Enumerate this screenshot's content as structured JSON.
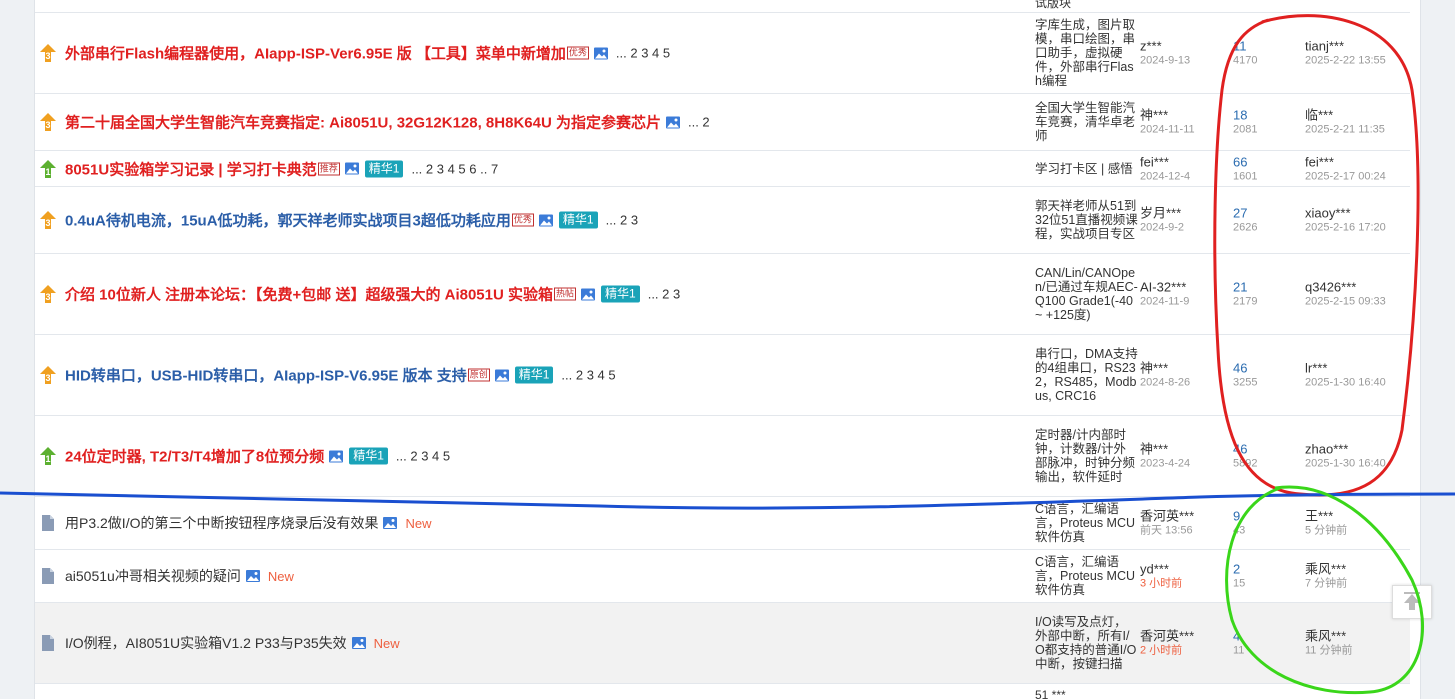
{
  "top_partial": "试版块",
  "bottom_partial": "51 ***",
  "threads": [
    {
      "title": "外部串行Flash编程器使用，AIapp-ISP-Ver6.95E 版 【工具】菜单中新增加",
      "color": "red",
      "icon": "orange",
      "badge": "优秀",
      "jinghua": "",
      "pages": "... 2 3 4 5",
      "forum": "字库生成，图片取模，串口绘图，串口助手，虚拟硬件，外部串行Flash编程",
      "author": "z***",
      "date": "2024-9-13",
      "replies": "11",
      "views": "4170",
      "last_user": "tianj***",
      "last_time": "2025-2-22 13:55"
    },
    {
      "title": "第二十届全国大学生智能汽车竞赛指定: Ai8051U, 32G12K128, 8H8K64U 为指定参赛芯片",
      "color": "red",
      "icon": "orange",
      "badge": "",
      "jinghua": "",
      "pages": "... 2",
      "forum": "全国大学生智能汽车竞赛，清华卓老师",
      "author": "神***",
      "date": "2024-11-11",
      "replies": "18",
      "views": "2081",
      "last_user": "临***",
      "last_time": "2025-2-21 11:35"
    },
    {
      "title": "8051U实验箱学习记录 | 学习打卡典范",
      "color": "red",
      "icon": "green",
      "badge": "推荐",
      "jinghua": "精华1",
      "pages": "... 2 3 4 5 6 .. 7",
      "forum": "学习打卡区 | 感悟",
      "author": "fei***",
      "date": "2024-12-4",
      "replies": "66",
      "views": "1601",
      "last_user": "fei***",
      "last_time": "2025-2-17 00:24"
    },
    {
      "title": "0.4uA待机电流，15uA低功耗，郭天祥老师实战项目3超低功耗应用",
      "color": "blue",
      "icon": "orange",
      "badge": "优秀",
      "jinghua": "精华1",
      "pages": "... 2 3",
      "forum": "郭天祥老师从51到32位51直播视频课程，实战项目专区",
      "author": "岁月***",
      "date": "2024-9-2",
      "replies": "27",
      "views": "2626",
      "last_user": "xiaoy***",
      "last_time": "2025-2-16 17:20"
    },
    {
      "title": "介绍 10位新人 注册本论坛：【免费+包邮 送】超级强大的 Ai8051U 实验箱",
      "color": "red",
      "icon": "orange",
      "badge": "热帖",
      "jinghua": "精华1",
      "pages": "... 2 3",
      "forum": "CAN/Lin/CANOpen/已通过车规AEC-Q100 Grade1(-40 ~ +125度)",
      "author": "AI-32***",
      "date": "2024-11-9",
      "replies": "21",
      "views": "2179",
      "last_user": "q3426***",
      "last_time": "2025-2-15 09:33"
    },
    {
      "title": "HID转串口，USB-HID转串口，AIapp-ISP-V6.95E 版本 支持",
      "color": "blue",
      "icon": "orange",
      "badge": "原创",
      "jinghua": "精华1",
      "pages": "... 2 3 4 5",
      "forum": "串行口，DMA支持的4组串口，RS232，RS485，Modbus, CRC16",
      "author": "神***",
      "date": "2024-8-26",
      "replies": "46",
      "views": "3255",
      "last_user": "lr***",
      "last_time": "2025-1-30 16:40"
    },
    {
      "title": "24位定时器, T2/T3/T4增加了8位预分频",
      "color": "red",
      "icon": "green",
      "badge": "",
      "jinghua": "精华1",
      "pages": "... 2 3 4 5",
      "forum": "定时器/计内部时钟，计数器/计外部脉冲，时钟分频输出，软件延时",
      "author": "神***",
      "date": "2023-4-24",
      "replies": "46",
      "views": "5892",
      "last_user": "zhao***",
      "last_time": "2025-1-30 16:40"
    },
    {
      "title": "用P3.2做I/O的第三个中断按钮程序烧录后没有效果",
      "color": "norm",
      "icon": "doc",
      "badge": "",
      "jinghua": "",
      "pages": "",
      "new": "New",
      "forum": "C语言，汇编语言，Proteus MCU软件仿真",
      "author": "香河英***",
      "date": "前天 13:56",
      "date_red": false,
      "replies": "9",
      "views": "43",
      "last_user": "王***",
      "last_time": "5 分钟前"
    },
    {
      "title": "ai5051u冲哥相关视频的疑问",
      "color": "norm",
      "icon": "doc",
      "badge": "",
      "jinghua": "",
      "pages": "",
      "new": "New",
      "forum": "C语言，汇编语言，Proteus MCU软件仿真",
      "author": "yd***",
      "date": "3 小时前",
      "date_red": true,
      "replies": "2",
      "views": "15",
      "last_user": "乘风***",
      "last_time": "7 分钟前"
    },
    {
      "title": "I/O例程，AI8051U实验箱V1.2 P33与P35失效",
      "color": "norm",
      "icon": "doc",
      "badge": "",
      "jinghua": "",
      "pages": "",
      "new": "New",
      "forum": "I/O读写及点灯，外部中断，所有I/O都支持的普通I/O中断，按键扫描",
      "author": "香河英***",
      "date": "2 小时前",
      "date_red": true,
      "replies": "4",
      "views": "11",
      "last_user": "乘风***",
      "last_time": "11 分钟前"
    }
  ],
  "colors": {
    "red_title": "#e02020",
    "blue_title": "#2b5ea8",
    "jinghua_bg": "#1aa3b8",
    "annotation_red": "#e02020",
    "annotation_blue": "#1a4fd0",
    "annotation_green": "#3ad61a"
  }
}
